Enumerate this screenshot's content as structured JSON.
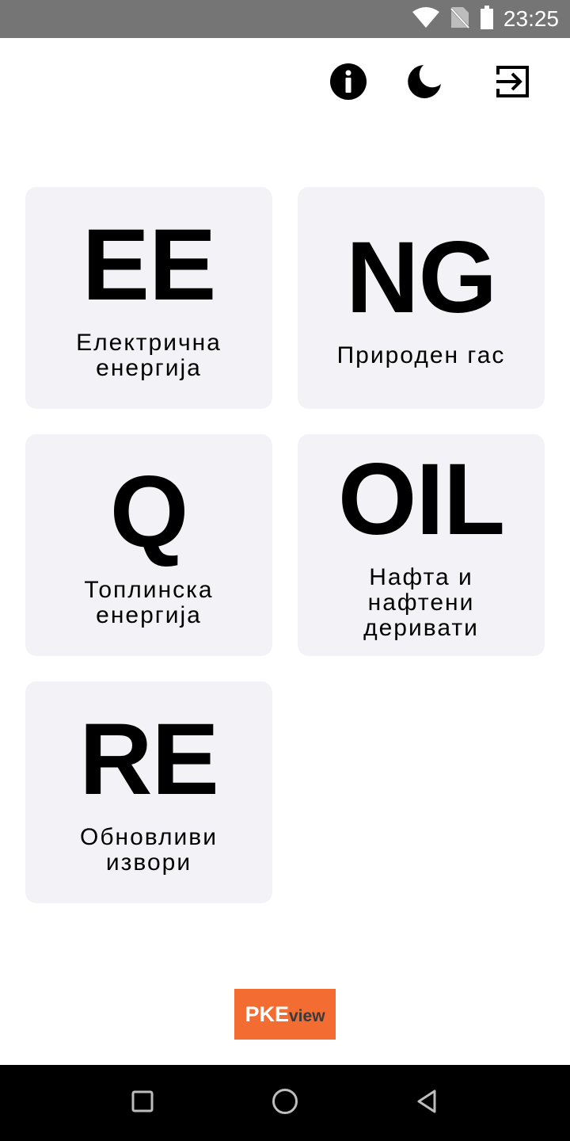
{
  "status_bar": {
    "time": "23:25",
    "icons": [
      "wifi-icon",
      "no-sim-icon",
      "battery-icon"
    ]
  },
  "toolbar": {
    "icons": [
      "info-icon",
      "dark-mode-moon-icon",
      "logout-icon"
    ]
  },
  "tiles": [
    {
      "abbr": "EE",
      "label": "Електрична\nенергија"
    },
    {
      "abbr": "NG",
      "label": "Природен гас"
    },
    {
      "abbr": "Q",
      "label": "Топлинска\nенергија"
    },
    {
      "abbr": "OIL",
      "label": "Нафта и\nнафтени\nдеривати"
    },
    {
      "abbr": "RE",
      "label": "Обновливи\nизвори"
    }
  ],
  "logo": {
    "part1": "PKE",
    "part2": "view"
  },
  "colors": {
    "status_bar": "#757575",
    "tile_bg": "#f3f3f7",
    "logo_bg": "#f36c32",
    "nav_bar": "#000000"
  },
  "nav_bar": {
    "icons": [
      "recents-square-icon",
      "home-circle-icon",
      "back-triangle-icon"
    ]
  }
}
